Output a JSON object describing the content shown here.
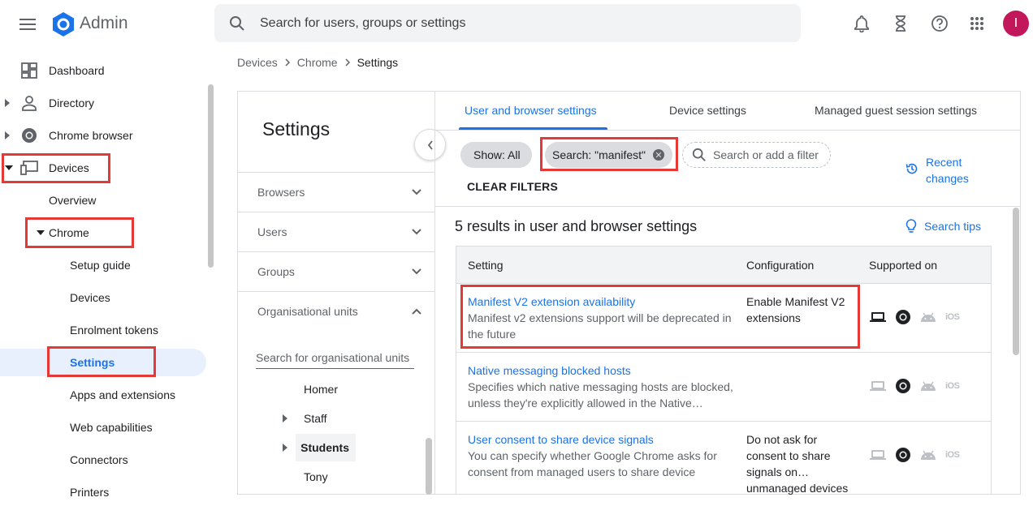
{
  "app": {
    "title": "Admin",
    "avatar_initial": "I",
    "brand_color": "#1a73e8",
    "avatar_color": "#c2185b",
    "highlight_color": "#e53935"
  },
  "topbar": {
    "search_placeholder": "Search for users, groups or settings",
    "icons": [
      "menu-icon",
      "bell-icon",
      "hourglass-icon",
      "help-icon",
      "apps-grid-icon"
    ]
  },
  "sidebar": {
    "items": [
      {
        "label": "Dashboard",
        "icon": "dashboard-icon"
      },
      {
        "label": "Directory",
        "icon": "person-icon"
      },
      {
        "label": "Chrome browser",
        "icon": "chrome-icon"
      },
      {
        "label": "Devices",
        "icon": "devices-icon"
      },
      {
        "label": "Overview"
      },
      {
        "label": "Chrome"
      },
      {
        "label": "Setup guide"
      },
      {
        "label": "Devices"
      },
      {
        "label": "Enrolment tokens"
      },
      {
        "label": "Settings",
        "selected": true
      },
      {
        "label": "Apps and extensions"
      },
      {
        "label": "Web capabilities"
      },
      {
        "label": "Connectors"
      },
      {
        "label": "Printers"
      }
    ]
  },
  "breadcrumb": [
    "Devices",
    "Chrome",
    "Settings"
  ],
  "settings_panel": {
    "title": "Settings",
    "filters": [
      "Browsers",
      "Users",
      "Groups",
      "Organisational units"
    ],
    "ou_search_placeholder": "Search for organisational units",
    "ou_items": [
      "Homer",
      "Staff",
      "Students",
      "Tony"
    ]
  },
  "tabs": [
    "User and browser settings",
    "Device settings",
    "Managed guest session settings"
  ],
  "filters": {
    "show_chip": "Show: All",
    "search_chip": "Search: \"manifest\"",
    "filter_placeholder": "Search or add a filter",
    "clear": "CLEAR FILTERS",
    "recent_changes": "Recent changes"
  },
  "results": {
    "count_text": "5 results in user and browser settings",
    "search_tips": "Search tips",
    "columns": [
      "Setting",
      "Configuration",
      "Supported on"
    ],
    "rows": [
      {
        "name": "Manifest V2 extension availability",
        "desc": "Manifest v2 extensions support will be deprecated in the future",
        "config": "Enable Manifest V2 extensions"
      },
      {
        "name": "Native messaging blocked hosts",
        "desc": "Specifies which native messaging hosts are blocked, unless they're explicitly allowed in the Native…",
        "config": ""
      },
      {
        "name": "User consent to share device signals",
        "desc": "You can specify whether Google Chrome asks for consent from managed users to share device signa…",
        "config": "Do not ask for consent to share signals on… unmanaged devices"
      }
    ],
    "ios_label": "iOS"
  }
}
